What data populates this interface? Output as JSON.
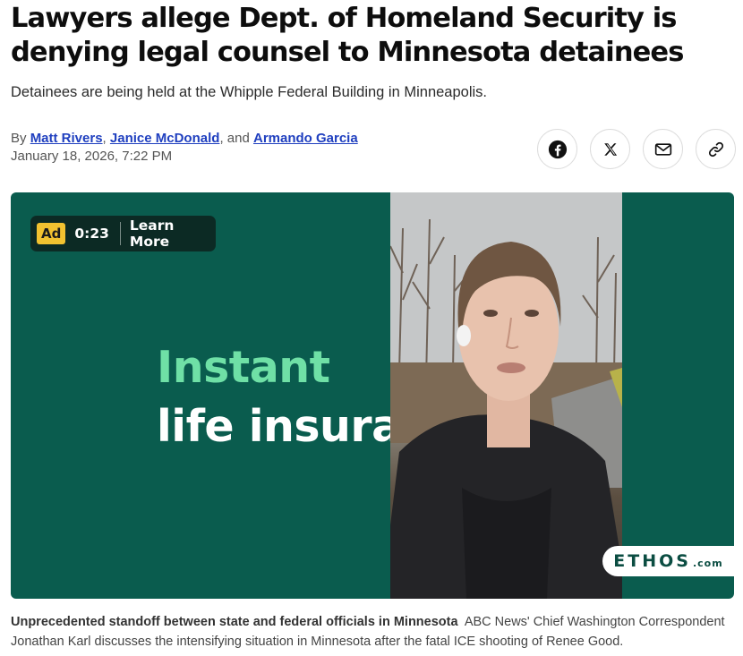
{
  "article": {
    "headline": "Lawyers allege Dept. of Homeland Security is denying legal counsel to Minnesota detainees",
    "dek": "Detainees are being held at the Whipple Federal Building in Minneapolis.",
    "byline": {
      "prefix": "By",
      "authors": [
        "Matt Rivers",
        "Janice McDonald",
        "Armando Garcia"
      ],
      "sep1": ",",
      "sep2": ", and",
      "date": "January 18, 2026, 7:22 PM"
    },
    "share": [
      "facebook-icon",
      "x-icon",
      "email-icon",
      "link-icon"
    ]
  },
  "video": {
    "ad_badge": "Ad",
    "ad_time": "0:23",
    "ad_link": "Learn More",
    "promo_line1": "Instant",
    "promo_line2": "life insura",
    "brand": "ETHOS",
    "brand_suffix": ".com",
    "colors": {
      "background": "#0a5c4e",
      "promo_accent": "#6fe0a6",
      "ad_badge": "#f2c230"
    }
  },
  "caption": {
    "title": "Unprecedented standoff between state and federal officials in Minnesota",
    "text": "ABC News' Chief Washington Correspondent Jonathan Karl discusses the intensifying situation in Minnesota after the fatal ICE shooting of Renee Good."
  }
}
